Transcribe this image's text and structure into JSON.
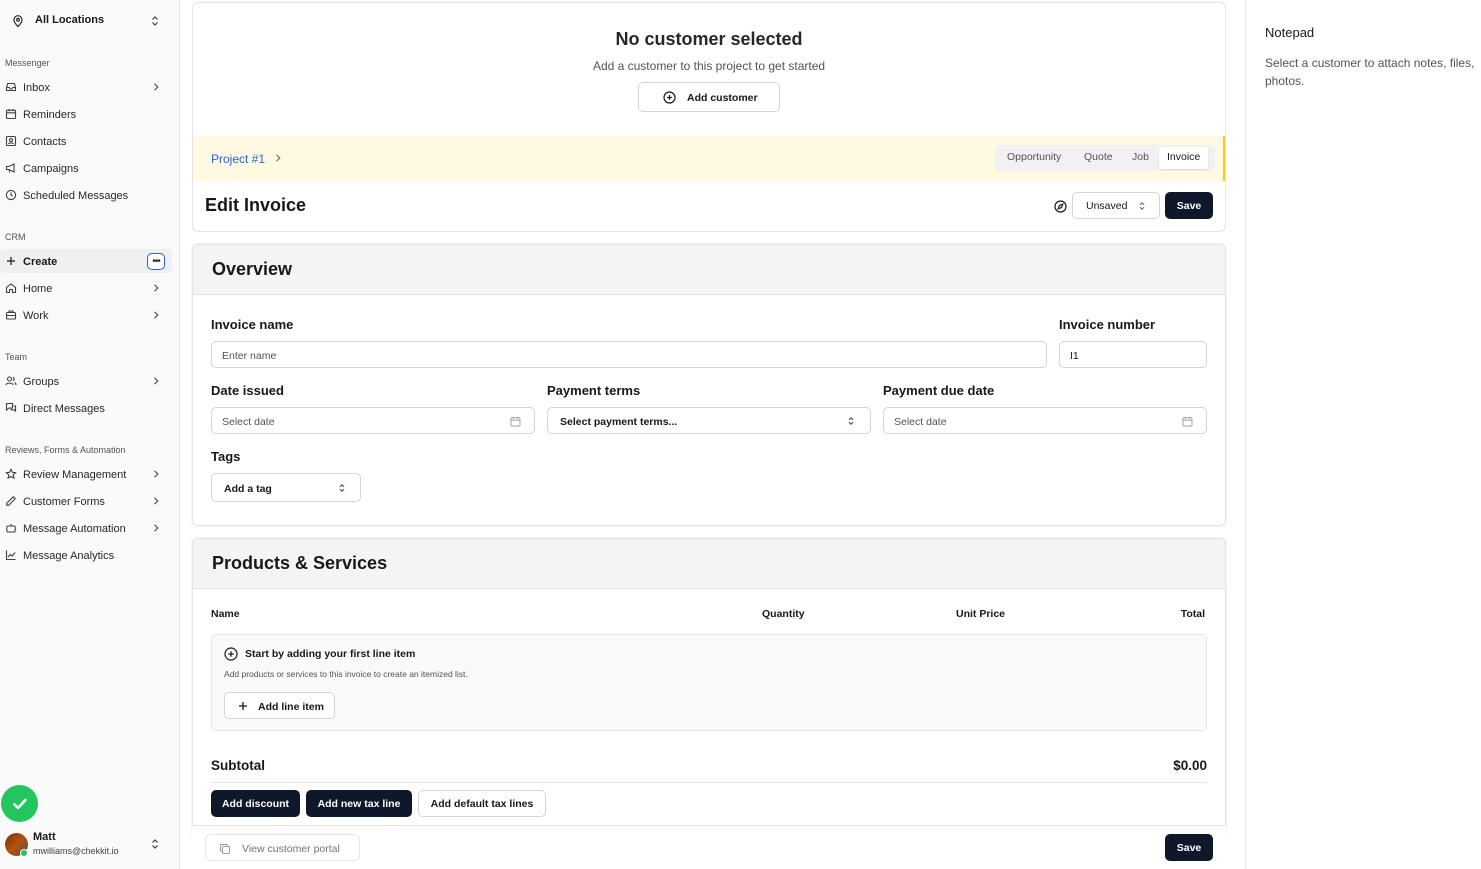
{
  "sidebar": {
    "location": "All Locations",
    "sections": {
      "messenger": "Messenger",
      "crm": "CRM",
      "team": "Team",
      "reviews": "Reviews, Forms & Automation"
    },
    "items": {
      "inbox": "Inbox",
      "reminders": "Reminders",
      "contacts": "Contacts",
      "campaigns": "Campaigns",
      "scheduled": "Scheduled Messages",
      "create": "Create",
      "home": "Home",
      "work": "Work",
      "groups": "Groups",
      "direct": "Direct Messages",
      "review_mgmt": "Review Management",
      "customer_forms": "Customer Forms",
      "message_automation": "Message Automation",
      "message_analytics": "Message Analytics"
    },
    "user": {
      "name": "Matt",
      "email": "mwilliams@chekkit.io"
    }
  },
  "customer": {
    "title": "No customer selected",
    "subtitle": "Add a customer to this project to get started",
    "add_label": "Add customer"
  },
  "project": {
    "breadcrumb": "Project #1",
    "stages": [
      "Opportunity",
      "Quote",
      "Job",
      "Invoice"
    ],
    "active_stage": "Invoice"
  },
  "header": {
    "title": "Edit Invoice",
    "status": "Unsaved",
    "save_label": "Save"
  },
  "overview": {
    "title": "Overview",
    "invoice_name_label": "Invoice name",
    "invoice_name_placeholder": "Enter name",
    "invoice_number_label": "Invoice number",
    "invoice_number_value": "I1",
    "date_issued_label": "Date issued",
    "date_issued_placeholder": "Select date",
    "payment_terms_label": "Payment terms",
    "payment_terms_placeholder": "Select payment terms...",
    "payment_due_label": "Payment due date",
    "payment_due_placeholder": "Select date",
    "tags_label": "Tags",
    "tags_placeholder": "Add a tag"
  },
  "products": {
    "title": "Products & Services",
    "columns": {
      "name": "Name",
      "quantity": "Quantity",
      "unit_price": "Unit Price",
      "total": "Total"
    },
    "empty_title": "Start by adding your first line item",
    "empty_desc": "Add products or services to this invoice to create an itemized list.",
    "add_line_label": "Add line item",
    "subtotal_label": "Subtotal",
    "subtotal_value": "$0.00",
    "add_discount": "Add discount",
    "add_tax": "Add new tax line",
    "add_default_tax": "Add default tax lines"
  },
  "footer": {
    "portal_label": "View customer portal",
    "save_label": "Save"
  },
  "notepad": {
    "title": "Notepad",
    "text": "Select a customer to attach notes, files, photos."
  },
  "colors": {
    "accent": "#2563eb",
    "dark_button": "#0f172a",
    "project_bar": "#fef9e0",
    "success": "#22c55e"
  }
}
